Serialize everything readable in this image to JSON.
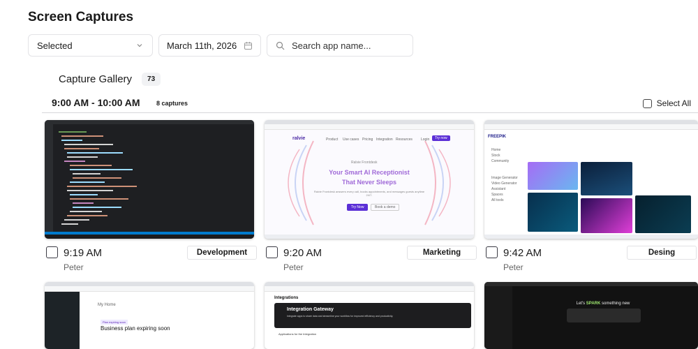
{
  "page": {
    "title": "Screen Captures"
  },
  "filters": {
    "selected_label": "Selected",
    "date_value": "March 11th, 2026",
    "search_placeholder": "Search app name..."
  },
  "gallery": {
    "title": "Capture Gallery",
    "count": "73"
  },
  "group": {
    "time_range": "9:00 AM - 10:00 AM",
    "captures": "8 captures",
    "select_all": "Select All"
  },
  "captures": [
    {
      "time": "9:19 AM",
      "user": "Peter",
      "tag": "Development"
    },
    {
      "time": "9:20 AM",
      "user": "Peter",
      "tag": "Marketing"
    },
    {
      "time": "9:42 AM",
      "user": "Peter",
      "tag": "Desing"
    }
  ],
  "shots": {
    "ralvie": {
      "brand": "ralvie",
      "nav": [
        "Product",
        "Use cases",
        "Pricing",
        "Integration",
        "Resources"
      ],
      "login": "Login",
      "cta": "Try now",
      "kicker": "Ralvie Frontdesk",
      "headline1": "Your Smart AI Receptionist",
      "headline2": "That Never Sleeps",
      "sub": "Ralvie Frontdesk answers every call, books appointments, and messages guests anytime 24/7.",
      "btn1": "Try Now",
      "btn2": "Book a demo"
    },
    "freepik": {
      "brand": "FREEPIK",
      "side": [
        "Home",
        "Stock",
        "Community",
        "Image Generator",
        "Video Generator",
        "Assistant",
        "Spaces",
        "All tools"
      ]
    },
    "wp": {
      "title": "My Home",
      "headline": "Business plan expiring soon",
      "badge": "Plan expiring soon"
    },
    "integration": {
      "title": "Integrations",
      "headline": "Integration Gateway",
      "sub": "Integrate apps to share data and streamline your workflow for improved efficiency and productivity.",
      "section": "Applications for the Integration"
    },
    "spark": {
      "prefix": "Let's ",
      "brand": "SPARK",
      "suffix": " something new"
    }
  }
}
